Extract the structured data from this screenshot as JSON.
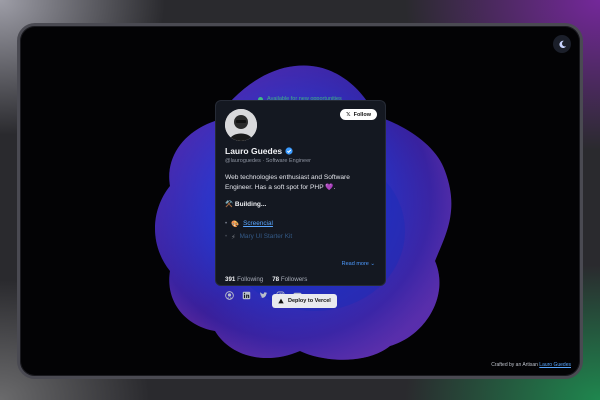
{
  "profile": {
    "availability": "Available for new opportunities",
    "follow_label": "Follow",
    "name": "Lauro Guedes",
    "handle": "@lauroguedes · Software Engineer",
    "bio": "Web technologies enthusiast and Software Engineer. Has a soft spot for PHP 💜.",
    "building_label": "Building...",
    "projects": [
      {
        "name": "Screencial",
        "icon": "🎨"
      },
      {
        "name": "Mary UI Starter Kit",
        "icon": "⚡"
      }
    ],
    "read_more": "Read more",
    "following_count": "391",
    "following_label": "Following",
    "followers_count": "78",
    "followers_label": "Followers",
    "socials": [
      "github-icon",
      "linkedin-icon",
      "twitter-icon",
      "instagram-icon",
      "youtube-icon"
    ]
  },
  "deploy": {
    "label": "Deploy to Vercel"
  },
  "footer": {
    "credit_text": "Crafted by an Artisan",
    "credit_link": "Lauro Guedes"
  },
  "colors": {
    "accent": "#58a6ff",
    "available": "#3fd27b",
    "card_bg": "#141821"
  }
}
